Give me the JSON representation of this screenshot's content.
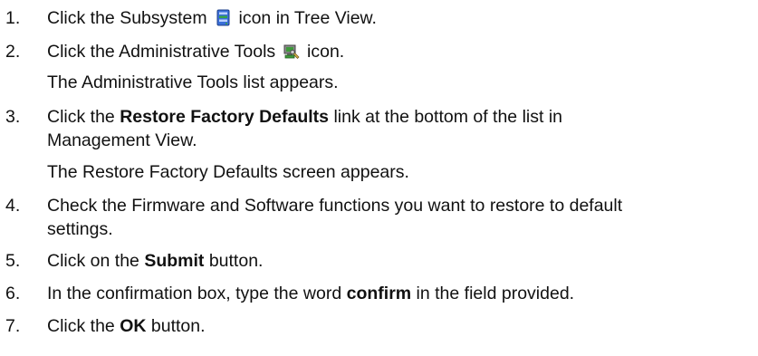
{
  "steps": [
    {
      "number": "1.",
      "text_before": "Click the Subsystem",
      "icon": "subsystem-icon",
      "text_after": "icon in Tree View."
    },
    {
      "number": "2.",
      "text_before": "Click the Administrative Tools",
      "icon": "administrative-tools-icon",
      "text_after": "icon.",
      "note": "The Administrative Tools list appears."
    },
    {
      "number": "3.",
      "text_before": "Click the",
      "bold": "Restore Factory Defaults",
      "text_after": "link at the bottom of the list in",
      "line2": "Management View.",
      "note": "The Restore Factory Defaults screen appears."
    },
    {
      "number": "4.",
      "text": "Check the Firmware and Software functions you want to restore to default",
      "line2": "settings."
    },
    {
      "number": "5.",
      "text_before": "Click on the",
      "bold": "Submit",
      "text_after": "button."
    },
    {
      "number": "6.",
      "text_before": "In the confirmation box, type the word",
      "bold": "confirm",
      "text_after": "in the field provided."
    },
    {
      "number": "7.",
      "text_before": "Click the",
      "bold": "OK",
      "text_after": "button."
    }
  ],
  "icon_colors": {
    "subsystem_blue": "#3a6fd8",
    "subsystem_green": "#35a347",
    "admin_green": "#3e9a3a",
    "admin_gray": "#8a8a8a"
  }
}
